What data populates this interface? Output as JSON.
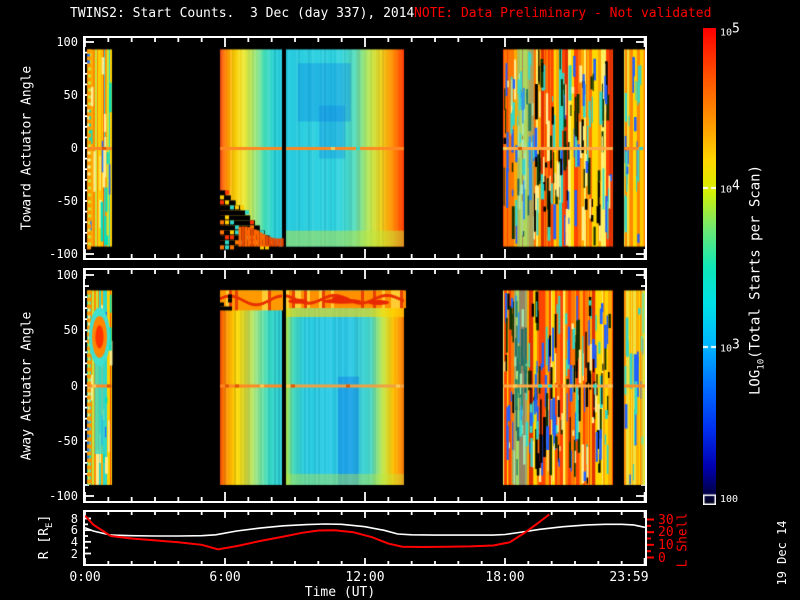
{
  "title": {
    "main": "TWINS2: Start Counts.  3 Dec (day 337), 2014",
    "note": "NOTE: Data Preliminary - Not validated"
  },
  "date_stamp": "19 Dec 14",
  "colors": {
    "background": "#000000",
    "axis": "#ffffff",
    "note": "#ff0000",
    "lshell": "#ff0000"
  },
  "time_axis": {
    "label": "Time (UT)",
    "range_hours": [
      0,
      24
    ],
    "minor_every_hours": 1,
    "major_every_hours": 6,
    "ticks": [
      {
        "hour": 0,
        "label": "0:00"
      },
      {
        "hour": 6,
        "label": "6:00"
      },
      {
        "hour": 12,
        "label": "12:00"
      },
      {
        "hour": 18,
        "label": "18:00"
      },
      {
        "hour": 23.983,
        "label": "23:59",
        "label_x": 629
      }
    ]
  },
  "colorbar": {
    "label_pre": "LOG",
    "label_sub": "10",
    "label_post": "(Total Starts per Scan)",
    "ticks": [
      {
        "base": "10",
        "exp": "5",
        "frac": 0.004
      },
      {
        "base": "10",
        "exp": "4",
        "frac": 0.333
      },
      {
        "base": "10",
        "exp": "3",
        "frac": 0.667
      },
      {
        "base": "100",
        "exp": "",
        "frac": 0.985
      }
    ],
    "gradient": [
      [
        0,
        "#ff0000"
      ],
      [
        0.1,
        "#ff5000"
      ],
      [
        0.2,
        "#ff9900"
      ],
      [
        0.28,
        "#ffd800"
      ],
      [
        0.34,
        "#d8f000"
      ],
      [
        0.42,
        "#70e870"
      ],
      [
        0.5,
        "#10e8b8"
      ],
      [
        0.58,
        "#00e0e8"
      ],
      [
        0.666,
        "#00b4ff"
      ],
      [
        0.75,
        "#0070ff"
      ],
      [
        0.84,
        "#0030f0"
      ],
      [
        0.92,
        "#0000b0"
      ],
      [
        0.98,
        "#000040"
      ],
      [
        1,
        "#000018"
      ]
    ]
  },
  "chart_data": [
    {
      "type": "heatmap",
      "panel": "toward",
      "ylabel": "Toward Actuator Angle",
      "yticks": [
        100,
        50,
        0,
        -50,
        -100
      ],
      "yrange": [
        -100,
        100
      ],
      "data_angle_range": [
        93,
        -93
      ],
      "seed": 7,
      "segments": [
        {
          "t0": 0.07,
          "t1": 1.17,
          "kind": "noisy",
          "palette": [
            "#ff8800",
            "#ffaa00",
            "#ffd000",
            "#c8e838",
            "#30d8c8",
            "#ff5500"
          ],
          "weights": [
            0.26,
            0.2,
            0.2,
            0.12,
            0.16,
            0.06
          ],
          "accents": [
            "#2070ff",
            "#00e0c0",
            "#ffee90"
          ],
          "accent_density": 0.5,
          "features": [
            {
              "fn": "leftdash"
            },
            {
              "fn": "hline",
              "a": 0,
              "h": 3,
              "color": "#ff8822"
            }
          ]
        },
        {
          "t0": 5.78,
          "t1": 8.45,
          "kind": "smooth",
          "stops": [
            [
              0,
              "#e03000"
            ],
            [
              0.05,
              "#ff6600"
            ],
            [
              0.12,
              "#ff9900"
            ],
            [
              0.22,
              "#ffcc00"
            ],
            [
              0.38,
              "#f0e830"
            ],
            [
              0.55,
              "#a8e870"
            ],
            [
              0.72,
              "#40ddb8"
            ],
            [
              0.88,
              "#28d2d8"
            ],
            [
              1,
              "#28cce0"
            ]
          ],
          "texture": 0.5,
          "features": [
            {
              "fn": "checker",
              "a0": -40,
              "a1": -93,
              "w0": 6,
              "w1": 64,
              "cell": 5,
              "density": 0.42,
              "colors": [
                "#ff7700",
                "#ff3300",
                "#ffcc00",
                "#30d8c8"
              ]
            },
            {
              "fn": "bottomband",
              "a0": -74,
              "rt0": 0.3,
              "color": "#e84800"
            },
            {
              "fn": "hline",
              "a": 0,
              "h": 3,
              "color": "#ff8822"
            }
          ]
        },
        {
          "t0": 8.62,
          "t1": 13.67,
          "kind": "smooth",
          "stops": [
            [
              0,
              "#28cce0"
            ],
            [
              0.45,
              "#30d4e0"
            ],
            [
              0.58,
              "#58dfc0"
            ],
            [
              0.7,
              "#b8e858"
            ],
            [
              0.8,
              "#f0d820"
            ],
            [
              0.9,
              "#ff9000"
            ],
            [
              1,
              "#ff3800"
            ]
          ],
          "texture": 0.32,
          "features": [
            {
              "fn": "swath",
              "rt0": 0.1,
              "rt1": 0.55,
              "a0": 80,
              "a1": 25,
              "color": "rgba(0,110,235,0.28)"
            },
            {
              "fn": "swath",
              "rt0": 0.28,
              "rt1": 0.5,
              "a0": 40,
              "a1": -10,
              "color": "rgba(0,100,230,0.22)"
            },
            {
              "fn": "band",
              "a0": -78,
              "a1": -93,
              "color": "rgba(190,230,60,0.5)"
            },
            {
              "fn": "hline",
              "a": 0,
              "h": 3,
              "color": "#ff8822"
            }
          ]
        },
        {
          "t0": 17.93,
          "t1": 22.62,
          "kind": "noisy",
          "palette": [
            "#ff7700",
            "#ff4400",
            "#ffaa00",
            "#ffd800",
            "#e03000",
            "#fff060",
            "#30d8c8"
          ],
          "weights": [
            0.24,
            0.2,
            0.2,
            0.14,
            0.1,
            0.07,
            0.05
          ],
          "accents": [
            "#30d8c8",
            "#2060ff",
            "#103000",
            "#ffee90",
            "#000000"
          ],
          "accent_density": 0.9,
          "features": [
            {
              "fn": "vband",
              "rt0": 0.13,
              "rt1": 0.28,
              "color": "rgba(70,220,205,0.45)"
            },
            {
              "fn": "hline",
              "a": 0,
              "h": 3,
              "color": "#ffaa44"
            }
          ]
        },
        {
          "t0": 23.08,
          "t1": 24,
          "kind": "noisy",
          "palette": [
            "#ffcc00",
            "#ffaa00",
            "#ff8800",
            "#f0e040",
            "#ffd800"
          ],
          "weights": [
            0.28,
            0.25,
            0.2,
            0.15,
            0.12
          ],
          "accents": [
            "#30d8c8",
            "#2060ff"
          ],
          "accent_density": 0.5,
          "features": [
            {
              "fn": "hline",
              "a": 0,
              "h": 3,
              "color": "#ff8822"
            }
          ]
        }
      ]
    },
    {
      "type": "heatmap",
      "panel": "away",
      "ylabel": "Away Actuator Angle",
      "yticks": [
        100,
        50,
        0,
        -50,
        -100
      ],
      "yrange": [
        -100,
        100
      ],
      "data_angle_range": [
        86,
        -90
      ],
      "seed": 99,
      "segments": [
        {
          "t0": 0.07,
          "t1": 1.17,
          "kind": "noisy",
          "palette": [
            "#ff8800",
            "#ffaa00",
            "#ffd000",
            "#c8e838",
            "#30d8c8",
            "#ff5500"
          ],
          "weights": [
            0.24,
            0.2,
            0.18,
            0.12,
            0.2,
            0.06
          ],
          "accents": [
            "#2070ff",
            "#00e0c0",
            "#ffee90"
          ],
          "accent_density": 0.5,
          "features": [
            {
              "fn": "leftdash"
            },
            {
              "fn": "vband",
              "rt0": 0.3,
              "rt1": 0.72,
              "a0": 58,
              "a1": -62,
              "color": "rgba(56,216,200,0.8)"
            },
            {
              "fn": "blob",
              "rt": 0.5,
              "a": 44,
              "rw": 0.3,
              "ra": 19,
              "colors": [
                "#40e0d0",
                "#ff8800",
                "#ff3300"
              ]
            },
            {
              "fn": "hline",
              "a": 0,
              "h": 3,
              "color": "#ff8822"
            }
          ]
        },
        {
          "t0": 5.78,
          "t1": 8.45,
          "kind": "smooth",
          "stops": [
            [
              0,
              "#e84000"
            ],
            [
              0.06,
              "#ff7700"
            ],
            [
              0.14,
              "#ffaa00"
            ],
            [
              0.26,
              "#ffd800"
            ],
            [
              0.42,
              "#e8e838"
            ],
            [
              0.6,
              "#90e488"
            ],
            [
              0.78,
              "#38dcc4"
            ],
            [
              1,
              "#2cd0dc"
            ]
          ],
          "texture": 0.5,
          "features": [
            {
              "fn": "topband",
              "a0": 86,
              "a1": 68,
              "color": "#ff9900",
              "wave": "#e83000",
              "checker": true
            },
            {
              "fn": "hline",
              "a": 0,
              "h": 3,
              "color": "#ff8822"
            }
          ]
        },
        {
          "t0": 8.62,
          "t1": 13.67,
          "kind": "smooth",
          "stops": [
            [
              0,
              "#b0e848"
            ],
            [
              0.06,
              "#48dcc0"
            ],
            [
              0.16,
              "#2cd0e4"
            ],
            [
              0.55,
              "#2cc8e8"
            ],
            [
              0.72,
              "#48d8c8"
            ],
            [
              0.82,
              "#c0e848"
            ],
            [
              0.91,
              "#ffc000"
            ],
            [
              1,
              "#ff7700"
            ]
          ],
          "texture": 0.3,
          "features": [
            {
              "fn": "topband",
              "a0": 86,
              "a1": 70,
              "color": "#ff9000",
              "wave": "#e83000",
              "blobs": true
            },
            {
              "fn": "band",
              "a0": 70,
              "a1": 62,
              "color": "rgba(255,216,0,0.6)"
            },
            {
              "fn": "swath",
              "rt0": 0.44,
              "rt1": 0.62,
              "a0": 8,
              "a1": -90,
              "color": "rgba(0,90,235,0.3)"
            },
            {
              "fn": "band",
              "a0": -80,
              "a1": -90,
              "color": "rgba(190,230,60,0.4)"
            },
            {
              "fn": "hline",
              "a": 0,
              "h": 3,
              "color": "#f0a040"
            }
          ]
        },
        {
          "t0": 17.93,
          "t1": 22.62,
          "kind": "noisy",
          "palette": [
            "#ff7700",
            "#ff4400",
            "#ffaa00",
            "#ffd800",
            "#e03000",
            "#fff060",
            "#30d8c8"
          ],
          "weights": [
            0.26,
            0.22,
            0.2,
            0.12,
            0.1,
            0.06,
            0.04
          ],
          "accents": [
            "#30d8c8",
            "#2060ff",
            "#103000",
            "#ffee90",
            "#000000"
          ],
          "accent_density": 0.9,
          "features": [
            {
              "fn": "vband",
              "rt0": 0.1,
              "rt1": 0.22,
              "color": "rgba(70,220,205,0.5)"
            },
            {
              "fn": "hline",
              "a": 0,
              "h": 3,
              "color": "#ffaa44"
            }
          ]
        },
        {
          "t0": 23.08,
          "t1": 24,
          "kind": "noisy",
          "palette": [
            "#ffd800",
            "#ffb000",
            "#f0e040",
            "#ff9000",
            "#c8e838"
          ],
          "weights": [
            0.3,
            0.25,
            0.2,
            0.15,
            0.1
          ],
          "accents": [
            "#30d8c8",
            "#2060ff"
          ],
          "accent_density": 0.5,
          "features": [
            {
              "fn": "vband",
              "rt0": 0.82,
              "rt1": 1,
              "color": "rgba(200,235,90,0.55)"
            },
            {
              "fn": "hline",
              "a": 0,
              "h": 3,
              "color": "#ff8822"
            }
          ]
        }
      ]
    },
    {
      "type": "line",
      "panel": "orbit",
      "left_axis": {
        "label_pre": "R [R",
        "label_sub": "E",
        "label_post": "]",
        "ticks": [
          2,
          4,
          6,
          8
        ],
        "range": [
          2,
          8
        ]
      },
      "right_axis": {
        "label": "L Shell",
        "ticks": [
          0,
          10,
          20,
          30
        ],
        "range": [
          0,
          30
        ],
        "color": "#ff0000"
      },
      "series": [
        {
          "name": "R [RE]",
          "axis": "left",
          "color": "#ffffff",
          "x": [
            0,
            0.35,
            1.1,
            2,
            3,
            4,
            5,
            5.6,
            6.5,
            7.5,
            8.5,
            9.5,
            10.3,
            11,
            12,
            12.8,
            13.4,
            14,
            15,
            16,
            17,
            17.5,
            18,
            18.6,
            19.5,
            20.5,
            21.5,
            22.3,
            23,
            23.5,
            24
          ],
          "y": [
            6.4,
            5.85,
            5.15,
            5.05,
            5.0,
            5.0,
            5.05,
            5.2,
            5.85,
            6.35,
            6.75,
            6.95,
            7.05,
            7.0,
            6.6,
            6.0,
            5.35,
            5.2,
            5.15,
            5.15,
            5.15,
            5.15,
            5.25,
            5.6,
            6.15,
            6.6,
            6.9,
            7.0,
            7.0,
            6.9,
            6.5
          ]
        },
        {
          "name": "L Shell",
          "axis": "right",
          "color": "#ff0000",
          "x": [
            0,
            0.35,
            1.1,
            2,
            3,
            4,
            5,
            5.7,
            6.5,
            7.5,
            8.5,
            9.3,
            10,
            10.7,
            11.5,
            12.3,
            13,
            13.6,
            14.5,
            15.5,
            16.5,
            17.5,
            18.2,
            18.8,
            19.4,
            19.9
          ],
          "y": [
            33,
            26,
            17,
            15,
            13.5,
            12,
            10,
            6.5,
            9,
            13,
            16.5,
            19.5,
            21.3,
            21.5,
            20,
            16,
            11,
            8.5,
            8.3,
            8.5,
            8.8,
            9.5,
            12,
            19,
            27,
            34
          ]
        }
      ]
    }
  ]
}
